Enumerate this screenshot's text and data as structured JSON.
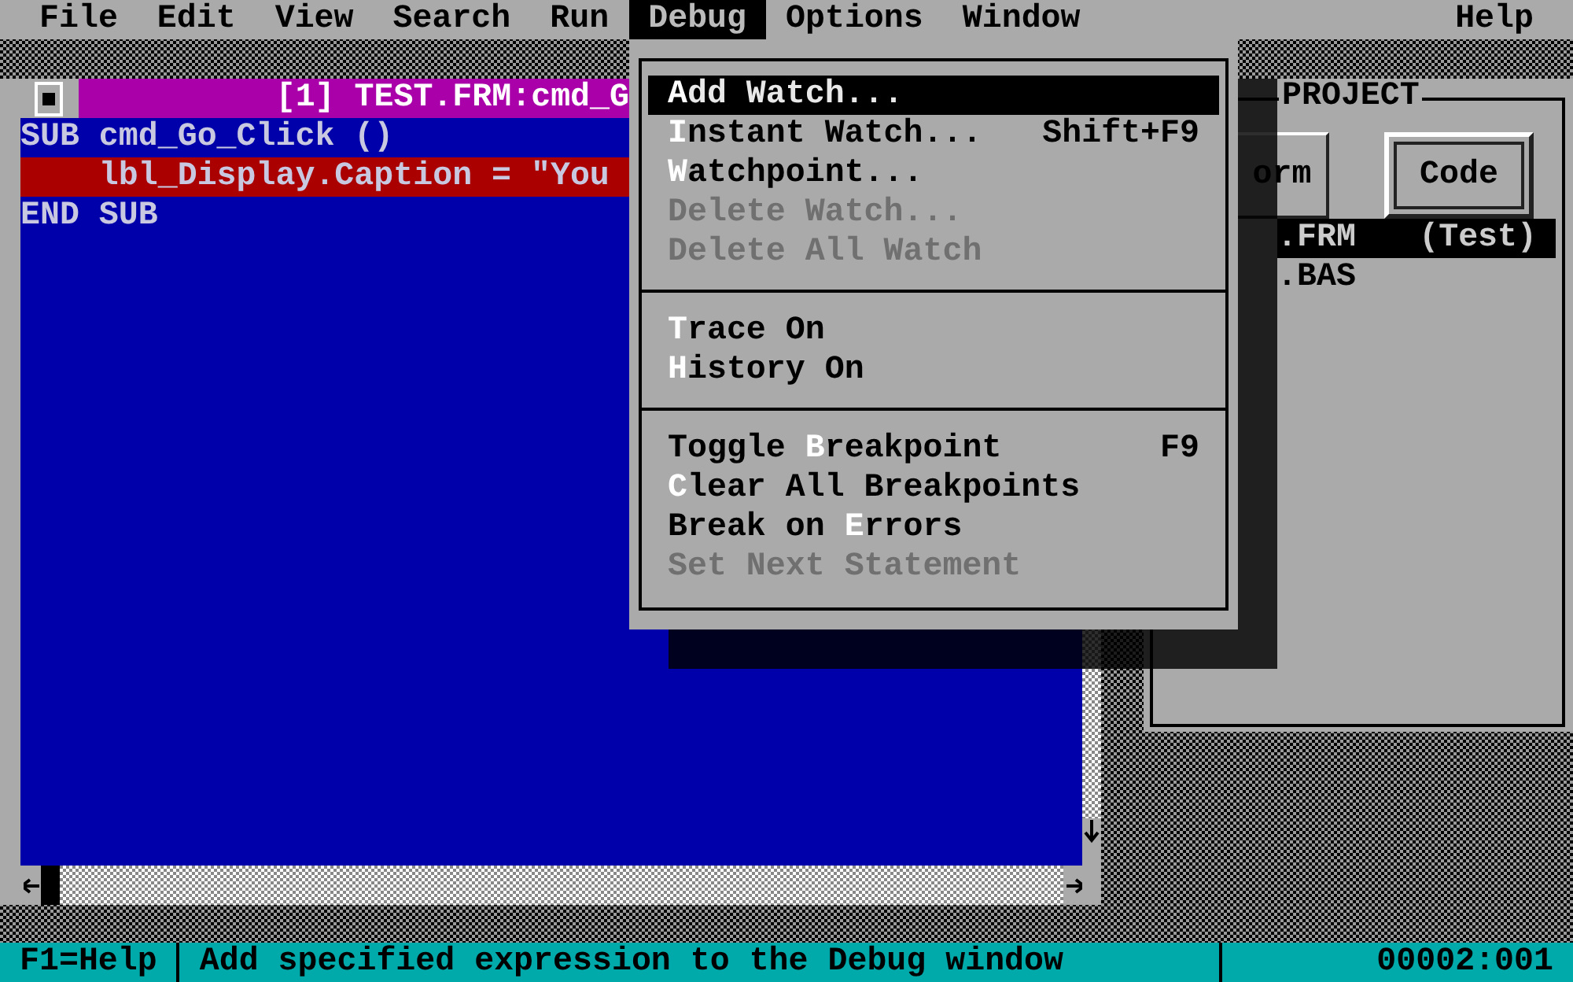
{
  "menu_bar": [
    {
      "label": "File",
      "selected": false
    },
    {
      "label": "Edit",
      "selected": false
    },
    {
      "label": "View",
      "selected": false
    },
    {
      "label": "Search",
      "selected": false
    },
    {
      "label": "Run",
      "selected": false
    },
    {
      "label": "Debug",
      "selected": true
    },
    {
      "label": "Options",
      "selected": false
    },
    {
      "label": "Window",
      "selected": false
    },
    {
      "label": "Help",
      "selected": false
    }
  ],
  "editor": {
    "title": "[1] TEST.FRM:cmd_G",
    "lines": [
      {
        "text": "SUB cmd_Go_Click ()",
        "current": false
      },
      {
        "text": "    lbl_Display.Caption = \"You",
        "current": true
      },
      {
        "text": "END SUB",
        "current": false
      }
    ]
  },
  "debug_menu": {
    "sections": [
      {
        "items": [
          {
            "label": "**A**dd Watch...",
            "selected": true,
            "disabled": false
          },
          {
            "label": "**I**nstant Watch...",
            "shortcut": "Shift+F9",
            "selected": false,
            "disabled": false
          },
          {
            "label": "**W**atchpoint...",
            "selected": false,
            "disabled": false
          },
          {
            "label": "Delete Watch...",
            "selected": false,
            "disabled": true
          },
          {
            "label": "Delete All Watch",
            "selected": false,
            "disabled": true
          }
        ]
      },
      {
        "items": [
          {
            "label": "**T**race On",
            "selected": false,
            "disabled": false
          },
          {
            "label": "**H**istory On",
            "selected": false,
            "disabled": false
          }
        ]
      },
      {
        "items": [
          {
            "label": "Toggle **B**reakpoint",
            "shortcut": "F9",
            "selected": false,
            "disabled": false
          },
          {
            "label": "**C**lear All Breakpoints",
            "selected": false,
            "disabled": false
          },
          {
            "label": "Break on **E**rrors",
            "selected": false,
            "disabled": false
          },
          {
            "label": "Set Next Statement",
            "selected": false,
            "disabled": true
          }
        ]
      }
    ]
  },
  "project": {
    "title": "PROJECT",
    "buttons": [
      {
        "label": "orm",
        "focused": false
      },
      {
        "label": "Code",
        "focused": true
      }
    ],
    "files": [
      {
        "name": ".FRM",
        "note": "(Test)",
        "selected": true
      },
      {
        "name": ".BAS",
        "selected": false
      }
    ]
  },
  "status_bar": {
    "help": "F1=Help",
    "message": "Add specified expression to the Debug window",
    "position": "00002:001"
  }
}
